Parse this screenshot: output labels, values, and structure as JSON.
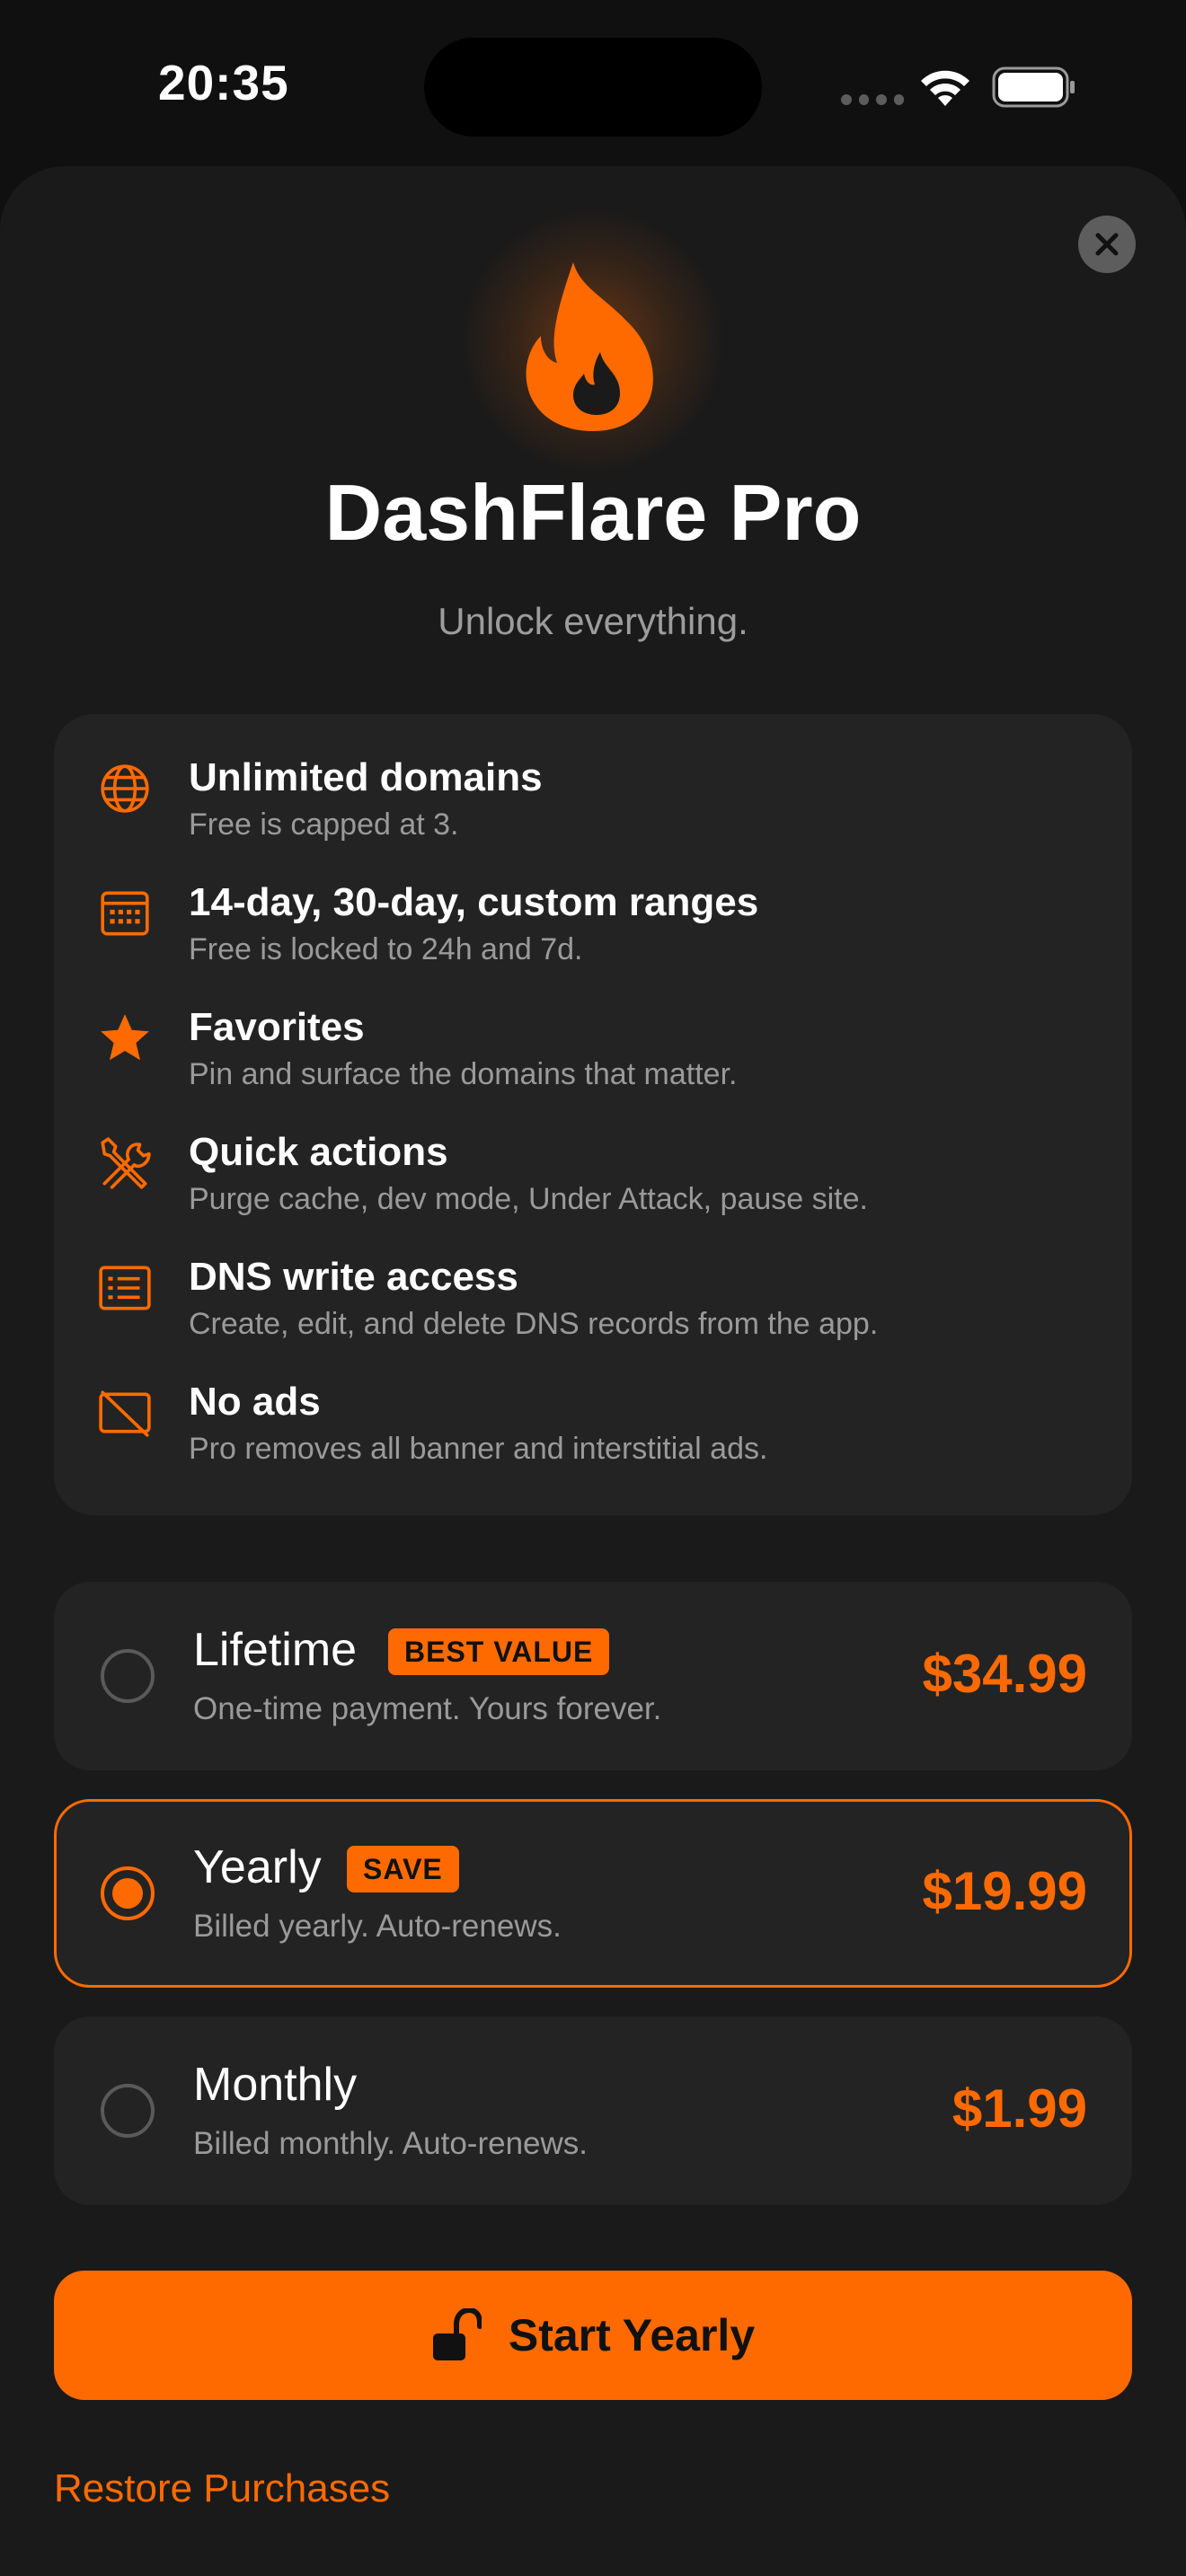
{
  "status_bar": {
    "time": "20:35"
  },
  "header": {
    "close_icon": "close-icon",
    "app_icon": "flame-icon",
    "title": "DashFlare Pro",
    "subtitle": "Unlock everything."
  },
  "accent_color": "#ff6a00",
  "features": [
    {
      "icon": "globe-icon",
      "title": "Unlimited domains",
      "desc": "Free is capped at 3."
    },
    {
      "icon": "calendar-icon",
      "title": "14-day, 30-day, custom ranges",
      "desc": "Free is locked to 24h and 7d."
    },
    {
      "icon": "star-icon",
      "title": "Favorites",
      "desc": "Pin and surface the domains that matter."
    },
    {
      "icon": "tools-icon",
      "title": "Quick actions",
      "desc": "Purge cache, dev mode, Under Attack, pause site."
    },
    {
      "icon": "list-icon",
      "title": "DNS write access",
      "desc": "Create, edit, and delete DNS records from the app."
    },
    {
      "icon": "no-ads-icon",
      "title": "No ads",
      "desc": "Pro removes all banner and interstitial ads."
    }
  ],
  "plans": [
    {
      "name": "Lifetime",
      "badge": "BEST VALUE",
      "desc": "One-time payment. Yours forever.",
      "price": "$34.99",
      "selected": false
    },
    {
      "name": "Yearly",
      "badge": "SAVE",
      "desc": "Billed yearly. Auto-renews.",
      "price": "$19.99",
      "selected": true
    },
    {
      "name": "Monthly",
      "badge": "",
      "desc": "Billed monthly. Auto-renews.",
      "price": "$1.99",
      "selected": false
    }
  ],
  "cta": {
    "icon": "unlock-icon",
    "label": "Start Yearly"
  },
  "restore_label": "Restore Purchases"
}
